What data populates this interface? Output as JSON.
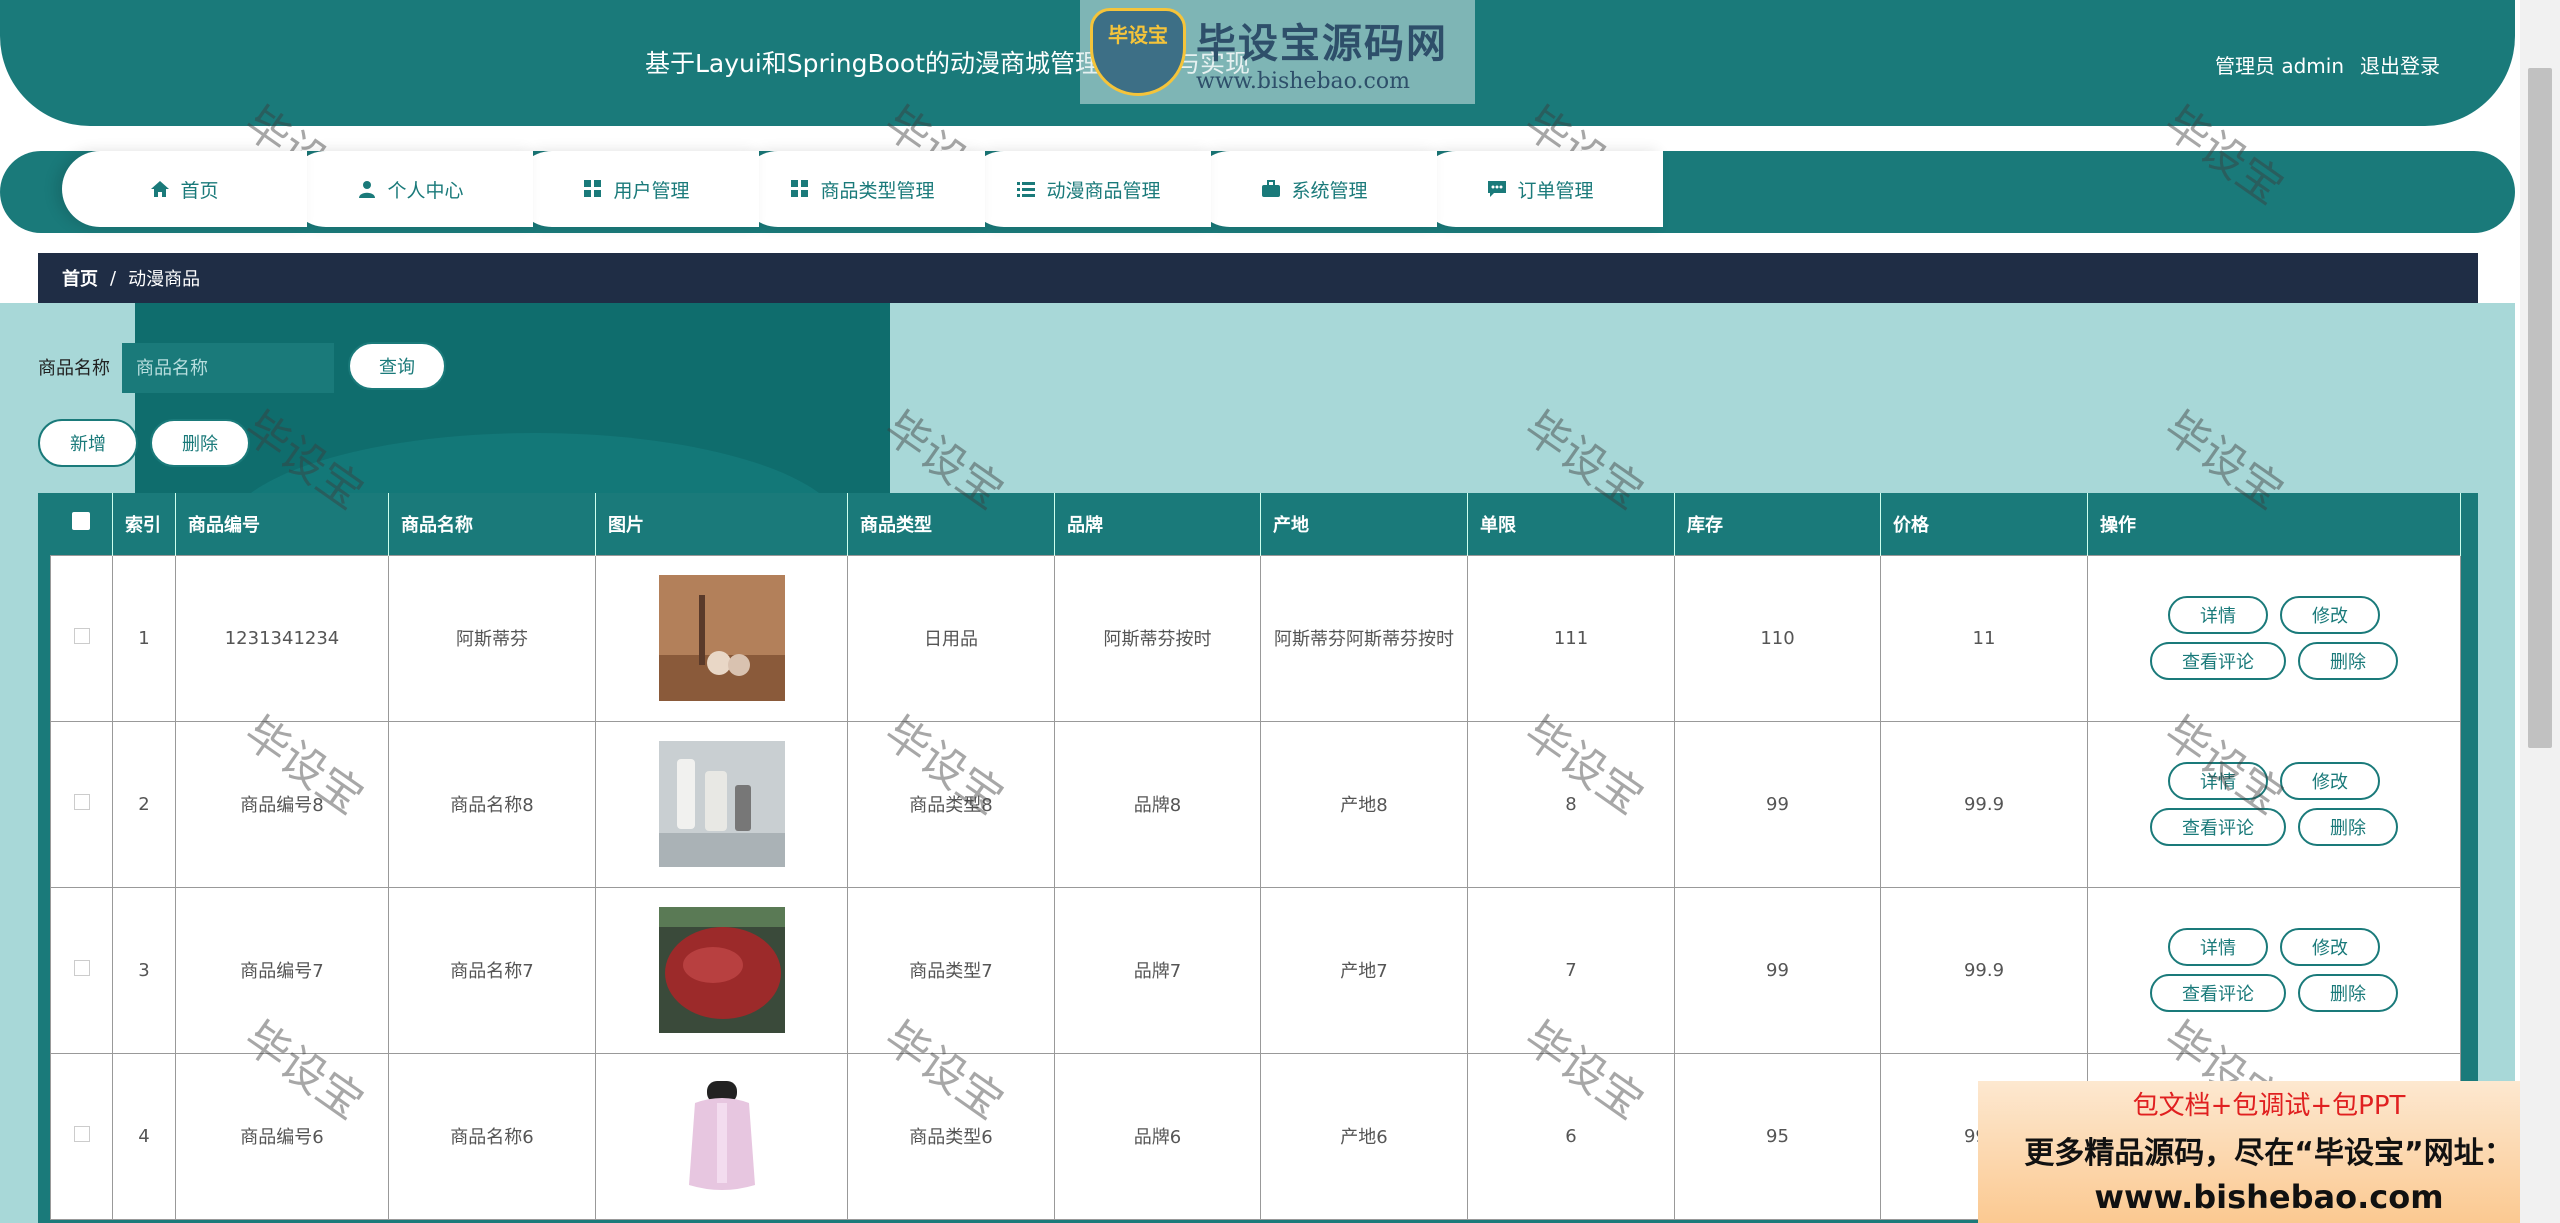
{
  "header": {
    "title": "基于Layui和SpringBoot的动漫商城管理的设计与实现",
    "user_label": "管理员 admin",
    "logout": "退出登录"
  },
  "logo_watermark": {
    "badge": "毕设宝",
    "brand": "毕设宝源码网",
    "url": "www.bishebao.com"
  },
  "nav": [
    {
      "label": "首页",
      "icon": "home-icon"
    },
    {
      "label": "个人中心",
      "icon": "user-icon"
    },
    {
      "label": "用户管理",
      "icon": "grid-icon"
    },
    {
      "label": "商品类型管理",
      "icon": "grid-icon"
    },
    {
      "label": "动漫商品管理",
      "icon": "list-icon"
    },
    {
      "label": "系统管理",
      "icon": "briefcase-icon"
    },
    {
      "label": "订单管理",
      "icon": "chat-icon"
    }
  ],
  "breadcrumb": {
    "home": "首页",
    "sep": "/",
    "current": "动漫商品"
  },
  "search": {
    "label": "商品名称",
    "placeholder": "商品名称",
    "button": "查询"
  },
  "actions": {
    "add": "新增",
    "delete": "删除"
  },
  "table": {
    "columns": [
      "索引",
      "商品编号",
      "商品名称",
      "图片",
      "商品类型",
      "品牌",
      "产地",
      "单限",
      "库存",
      "价格",
      "操作"
    ],
    "rows": [
      {
        "index": "1",
        "code": "1231341234",
        "name": "阿斯蒂芬",
        "type": "日用品",
        "brand": "阿斯蒂芬按时",
        "origin": "阿斯蒂芬阿斯蒂芬按时",
        "limit": "111",
        "stock": "110",
        "price": "11",
        "thumb_color": "#b3805a"
      },
      {
        "index": "2",
        "code": "商品编号8",
        "name": "商品名称8",
        "type": "商品类型8",
        "brand": "品牌8",
        "origin": "产地8",
        "limit": "8",
        "stock": "99",
        "price": "99.9",
        "thumb_color": "#9aa6ac"
      },
      {
        "index": "3",
        "code": "商品编号7",
        "name": "商品名称7",
        "type": "商品类型7",
        "brand": "品牌7",
        "origin": "产地7",
        "limit": "7",
        "stock": "99",
        "price": "99.9",
        "thumb_color": "#9c2a2a"
      },
      {
        "index": "4",
        "code": "商品编号6",
        "name": "商品名称6",
        "type": "商品类型6",
        "brand": "品牌6",
        "origin": "产地6",
        "limit": "6",
        "stock": "95",
        "price": "99.9",
        "thumb_color": "#e7c6e0"
      }
    ],
    "ops": {
      "detail": "详情",
      "edit": "修改",
      "comments": "查看评论",
      "delete": "删除"
    }
  },
  "watermark_text": "毕设宝",
  "promo": {
    "line1": "包文档+包调试+包PPT",
    "line2": "更多精品源码，尽在“毕设宝”网址：",
    "line3": "www.bishebao.com"
  },
  "colors": {
    "primary": "#1a7a7a",
    "breadcrumb_bg": "#1f2d45",
    "content_bg": "#a8d8d8"
  }
}
